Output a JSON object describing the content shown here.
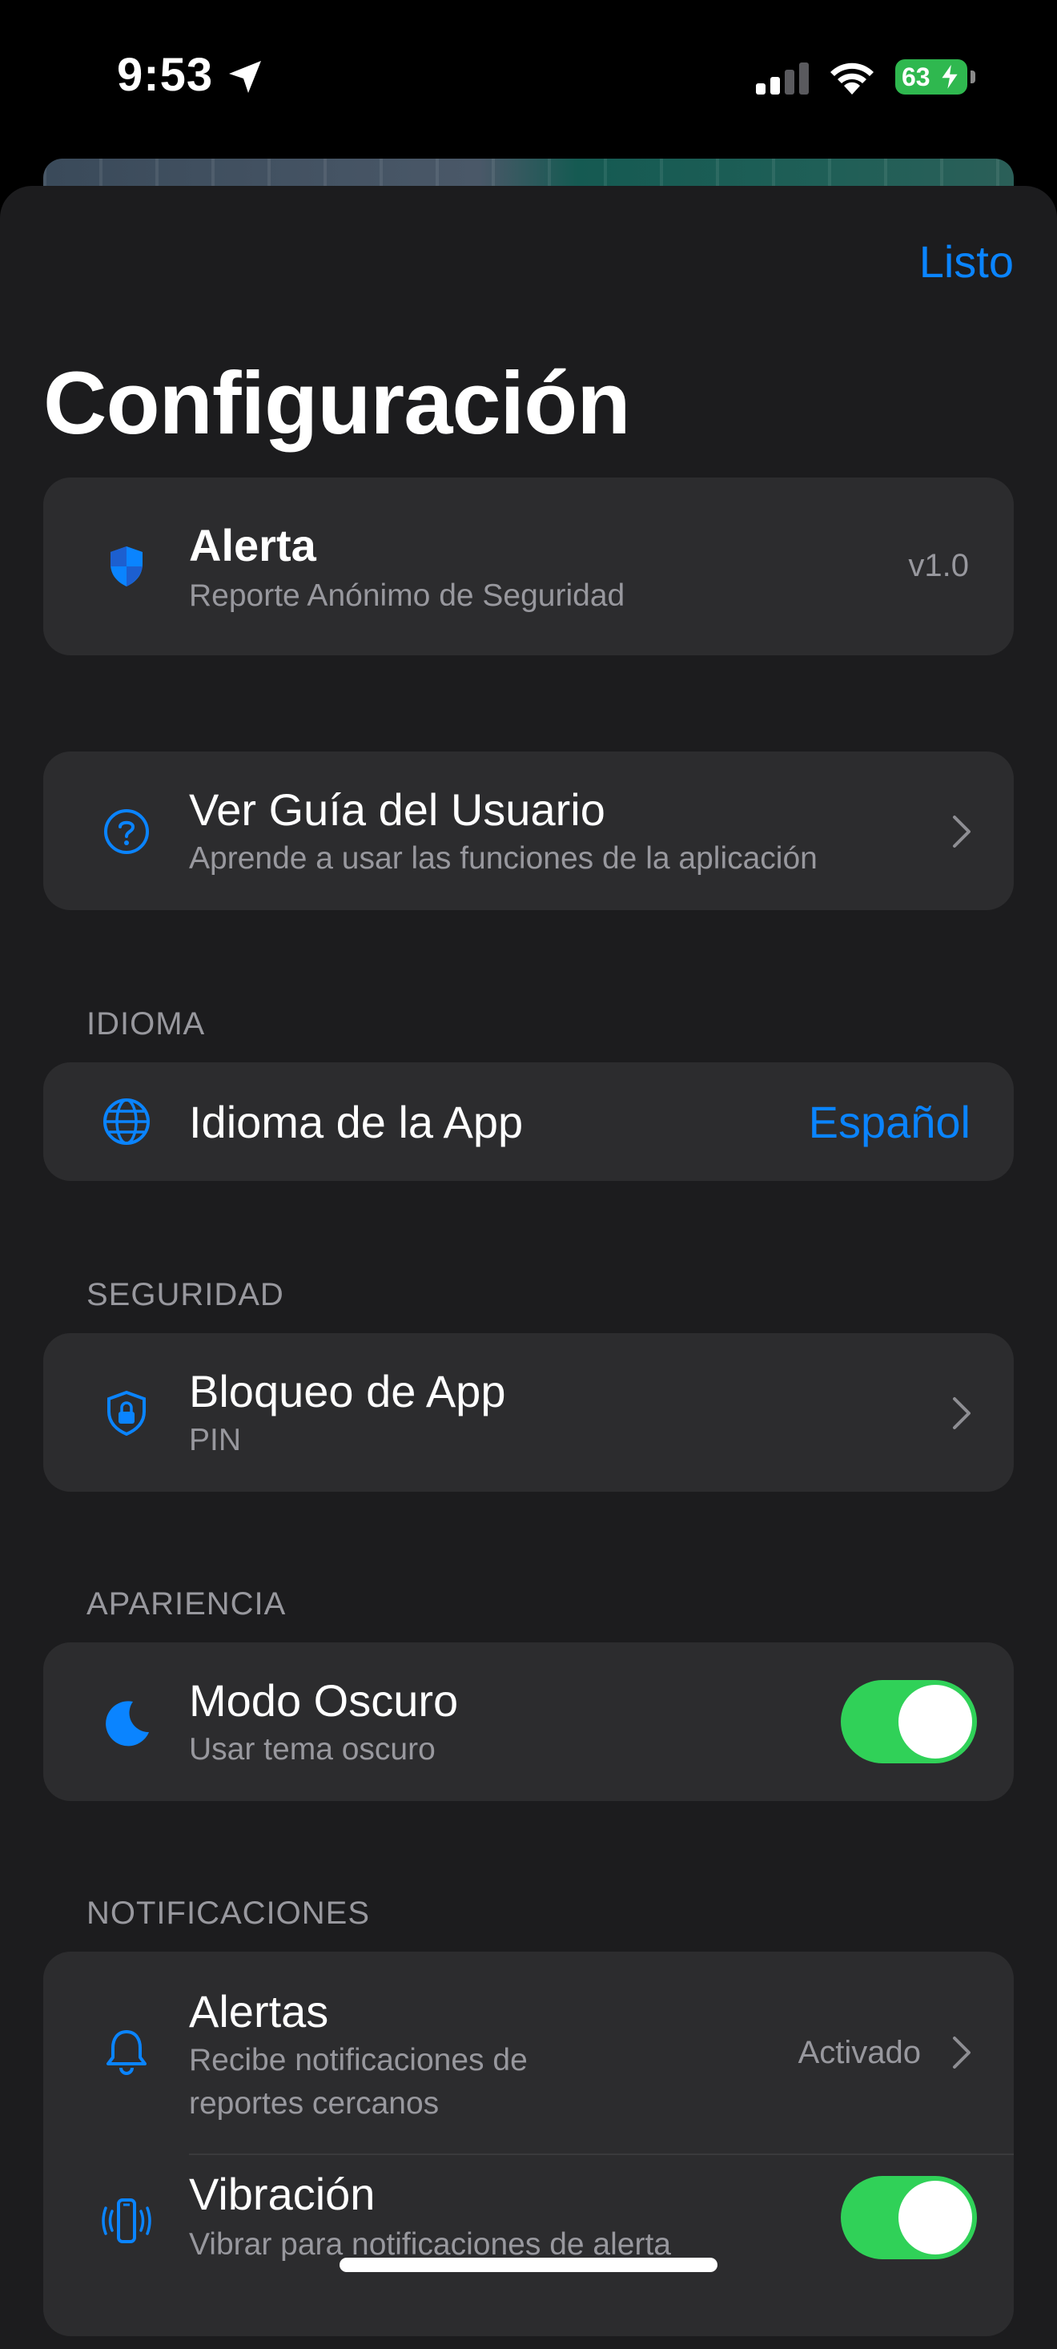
{
  "status_bar": {
    "time": "9:53",
    "battery": "63"
  },
  "header": {
    "done_label": "Listo",
    "title": "Configuración"
  },
  "app_info": {
    "name": "Alerta",
    "subtitle": "Reporte Anónimo de Seguridad",
    "version": "v1.0"
  },
  "guide": {
    "title": "Ver Guía del Usuario",
    "subtitle": "Aprende a usar las funciones de la aplicación"
  },
  "language": {
    "section": "IDIOMA",
    "label": "Idioma de la App",
    "value": "Español"
  },
  "security": {
    "section": "SEGURIDAD",
    "label": "Bloqueo de App",
    "value": "PIN"
  },
  "appearance": {
    "section": "APARIENCIA",
    "label": "Modo Oscuro",
    "subtitle": "Usar tema oscuro",
    "enabled": true
  },
  "notifications": {
    "section": "NOTIFICACIONES",
    "alerts": {
      "label": "Alertas",
      "subtitle_line1": "Recibe notificaciones de",
      "subtitle_line2": "reportes cercanos",
      "value": "Activado"
    },
    "vibration": {
      "label": "Vibración",
      "subtitle": "Vibrar para notificaciones de alerta",
      "enabled": true
    }
  },
  "colors": {
    "accent": "#0a84ff",
    "toggle_on": "#30d158",
    "card": "#2c2c2e",
    "sheet": "#1c1c1e"
  }
}
